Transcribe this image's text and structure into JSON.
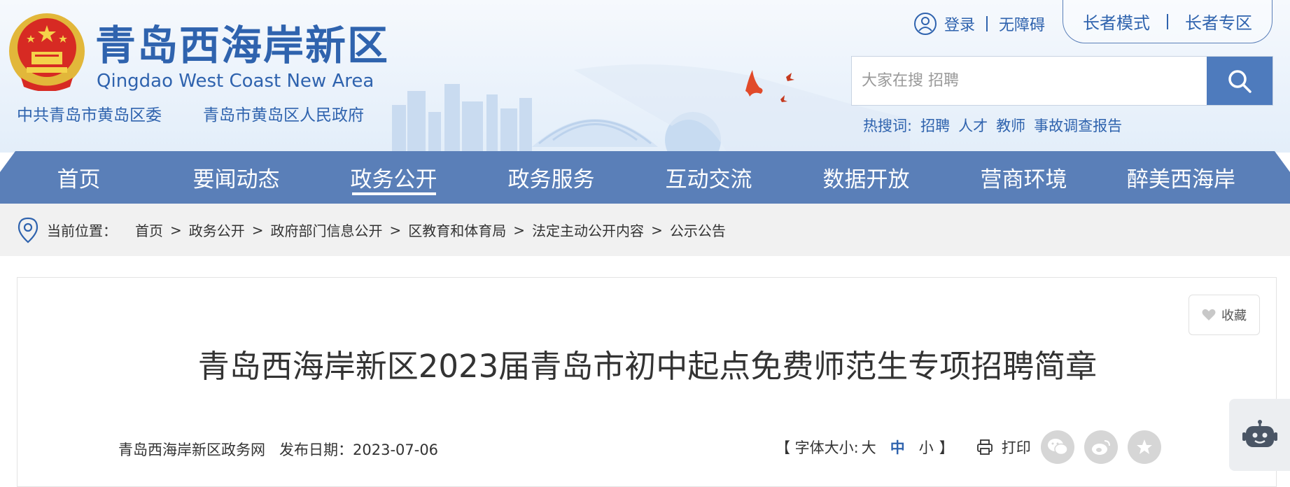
{
  "header": {
    "site_name": "青岛西海岸新区",
    "site_name_en": "Qingdao West Coast New Area",
    "org_party": "中共青岛市黄岛区委",
    "org_gov": "青岛市黄岛区人民政府",
    "emblem_icon": "national-emblem-icon",
    "login": "登录",
    "accessibility": "无障碍",
    "elder_mode": "长者模式",
    "elder_zone": "长者专区",
    "search_placeholder": "大家在搜 招聘",
    "hot_label": "热搜词:",
    "hot_words": [
      "招聘",
      "人才",
      "教师",
      "事故调查报告"
    ]
  },
  "nav": {
    "items": [
      "首页",
      "要闻动态",
      "政务公开",
      "政务服务",
      "互动交流",
      "数据开放",
      "营商环境",
      "醉美西海岸"
    ],
    "active_index": 2
  },
  "breadcrumb": {
    "label": "当前位置：",
    "items": [
      "首页",
      "政务公开",
      "政府部门信息公开",
      "区教育和体育局",
      "法定主动公开内容",
      "公示公告"
    ],
    "separator": ">"
  },
  "article": {
    "favorite": "收藏",
    "title": "青岛西海岸新区2023届青岛市初中起点免费师范生专项招聘简章",
    "source": "青岛西海岸新区政务网",
    "date_label": "发布日期：",
    "date": "2023-07-06",
    "font_size_label": "【 字体大小:",
    "font_large": "大",
    "font_medium": "中",
    "font_small": "小",
    "font_close": "】",
    "print": "打印"
  },
  "colors": {
    "brand_blue": "#2f63ae",
    "nav_blue": "#5a7fb8",
    "search_btn": "#4e7bbd"
  }
}
